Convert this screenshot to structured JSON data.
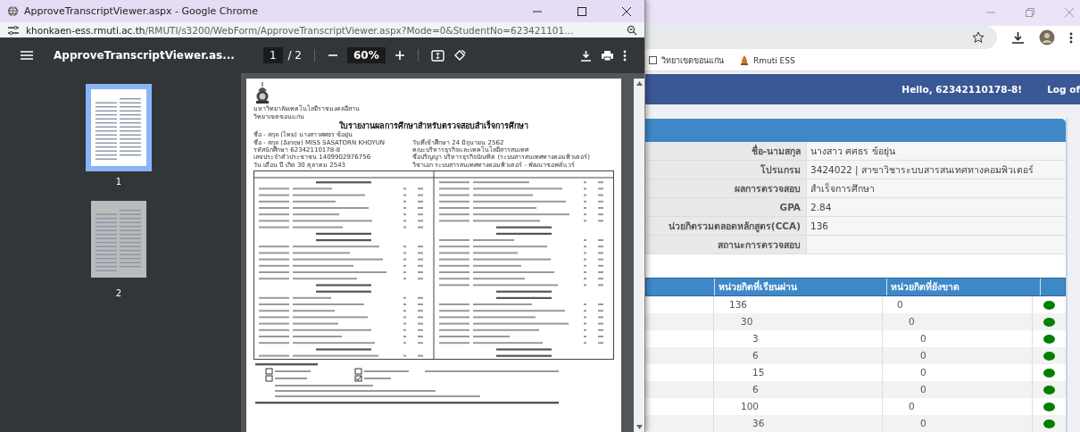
{
  "popup": {
    "title": "ApproveTranscriptViewer.aspx - Google Chrome",
    "url_host": "khonkaen-ess.rmuti.ac.th",
    "url_path": "/RMUTI/s3200/WebForm/ApproveTranscriptViewer.aspx?Mode=0&StudentNo=623421101...",
    "pdf_toolbar": {
      "filename": "ApproveTranscriptViewer.as...",
      "page": "1",
      "page_count": "/ 2",
      "zoom": "60%"
    },
    "thumbnails": [
      {
        "label": "1",
        "selected": true
      },
      {
        "label": "2",
        "selected": false
      }
    ],
    "document": {
      "university": "มหาวิทยาลัยเทคโนโลยีราชมงคลอีสาน",
      "campus": "วิทยาเขตขอนแก่น",
      "title": "ใบรายงานผลการศึกษาสำหรับตรวจสอบสำเร็จการศึกษา",
      "name_th": "ชื่อ - สกุล (ไทย) นางสาวศศธร  ข้อยุ่น",
      "info_left": [
        "ชื่อ - สกุล (อังกฤษ) MISS SASATORN  KHOYUN",
        "รหัสนักศึกษา  62342110178-8",
        "เลขประจำตัวประชาชน  1409902976756",
        "วัน เดือน ปี เกิด  30 ตุลาคม 2543"
      ],
      "info_right": [
        "วันที่เข้าศึกษา 24 มิถุนายน 2562",
        "คณะบริหารธุรกิจและเทคโนโลยีสารสนเทศ",
        "ชื่อปริญญา บริหารธุรกิจบัณฑิต (ระบบสารสนเทศทางคอมพิวเตอร์)",
        "วิชาเอก ระบบสารสนเทศทางคอมพิวเตอร์ - พัฒนาซอฟต์แวร์"
      ]
    }
  },
  "background": {
    "bookmarks": [
      {
        "label": "วิทยาเขตขอนแก่น"
      },
      {
        "label": "Rmuti ESS"
      }
    ],
    "greeting": "Hello, 62342110178-8!",
    "logout": "Log of",
    "info": [
      {
        "label": "ชื่อ-นามสกุล",
        "value": "นางสาว ศศธร ข้อยุ่น"
      },
      {
        "label": "โปรแกรม",
        "value": "3424022 | สาขาวิชาระบบสารสนเทศทางคอมพิวเตอร์"
      },
      {
        "label": "ผลการตรวจสอบ",
        "value": "สำเร็จการศึกษา"
      },
      {
        "label": "GPA",
        "value": "2.84"
      },
      {
        "label": "น่วยกิตรวมตลอดหลักสูตร(CCA)",
        "value": "136"
      },
      {
        "label": "สถานะการตรวจสอบ"
      }
    ],
    "credits": {
      "columns": [
        "หน่วยกิตที่เรียนผ่าน",
        "หน่วยกิตที่ยังขาด"
      ],
      "rows": [
        {
          "passed": "136",
          "missing": "0",
          "color": "#008000",
          "children": [
            {
              "passed": "30",
              "missing": "0",
              "color": "#008000",
              "children": [
                {
                  "passed": "3",
                  "missing": "0",
                  "color": "#008000"
                },
                {
                  "passed": "6",
                  "missing": "0",
                  "color": "#008000"
                },
                {
                  "passed": "15",
                  "missing": "0",
                  "color": "#008000"
                },
                {
                  "passed": "6",
                  "missing": "0",
                  "color": "#008000"
                }
              ]
            },
            {
              "passed": "100",
              "missing": "0",
              "color": "#008000",
              "children": [
                {
                  "passed": "36",
                  "missing": "0",
                  "color": "#008000"
                }
              ]
            }
          ]
        }
      ]
    }
  }
}
